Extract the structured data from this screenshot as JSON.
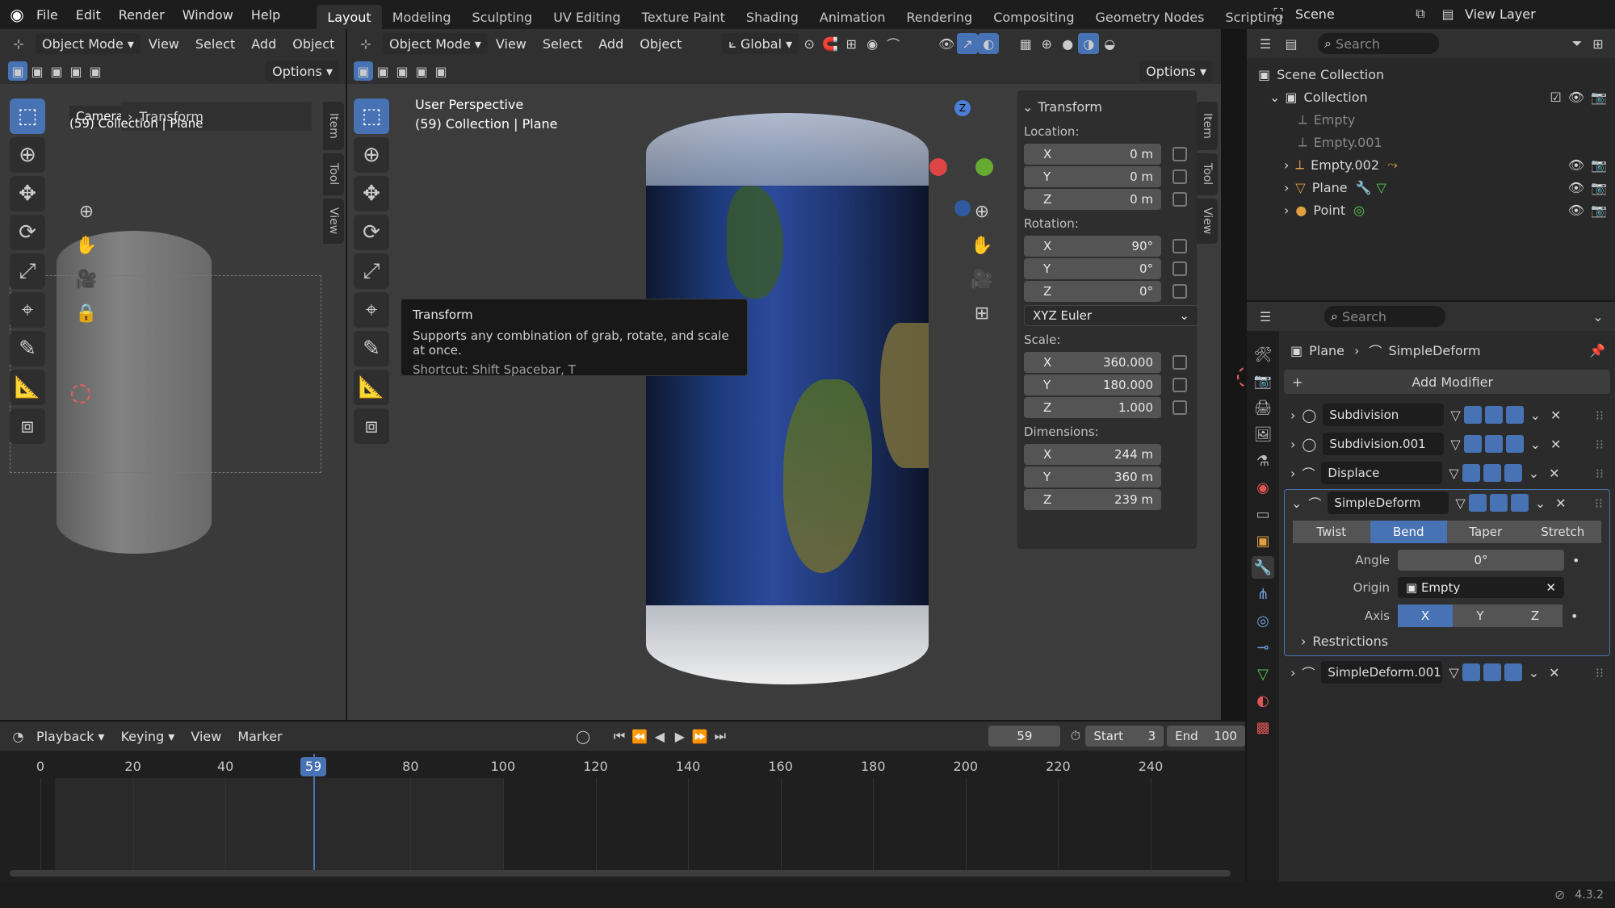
{
  "topbar": {
    "menus": [
      "File",
      "Edit",
      "Render",
      "Window",
      "Help"
    ],
    "workspaces": [
      "Layout",
      "Modeling",
      "Sculpting",
      "UV Editing",
      "Texture Paint",
      "Shading",
      "Animation",
      "Rendering",
      "Compositing",
      "Geometry Nodes",
      "Scripting"
    ],
    "active_workspace": "Layout",
    "add_tab": "+",
    "scene": "Scene",
    "view_layer": "View Layer"
  },
  "left_viewport": {
    "mode": "Object Mode",
    "menus": [
      "View",
      "Select",
      "Add",
      "Object"
    ],
    "options": "Options",
    "camera_title": "Camera I",
    "breadcrumb_transform": "Transform",
    "collection_info": "(59) Collection | Plane",
    "side_tabs": [
      "Item",
      "Tool",
      "View"
    ]
  },
  "main_viewport": {
    "mode": "Object Mode",
    "menus": [
      "View",
      "Select",
      "Add",
      "Object"
    ],
    "orientation": "Global",
    "options": "Options",
    "title": "User Perspective",
    "collection_info": "(59) Collection | Plane",
    "side_tabs": [
      "Item",
      "Tool",
      "View"
    ],
    "tooltip": {
      "title": "Transform",
      "description": "Supports any combination of grab, rotate, and scale at once.",
      "shortcut": "Shortcut: Shift Spacebar, T"
    },
    "gizmo": {
      "z": "Z"
    }
  },
  "transform_panel": {
    "header": "Transform",
    "location_label": "Location:",
    "location": [
      {
        "axis": "X",
        "value": "0 m"
      },
      {
        "axis": "Y",
        "value": "0 m"
      },
      {
        "axis": "Z",
        "value": "0 m"
      }
    ],
    "rotation_label": "Rotation:",
    "rotation": [
      {
        "axis": "X",
        "value": "90°"
      },
      {
        "axis": "Y",
        "value": "0°"
      },
      {
        "axis": "Z",
        "value": "0°"
      }
    ],
    "rotation_mode": "XYZ Euler",
    "scale_label": "Scale:",
    "scale": [
      {
        "axis": "X",
        "value": "360.000"
      },
      {
        "axis": "Y",
        "value": "180.000"
      },
      {
        "axis": "Z",
        "value": "1.000"
      }
    ],
    "dimensions_label": "Dimensions:",
    "dimensions": [
      {
        "axis": "X",
        "value": "244 m"
      },
      {
        "axis": "Y",
        "value": "360 m"
      },
      {
        "axis": "Z",
        "value": "239 m"
      }
    ]
  },
  "outliner": {
    "search_placeholder": "Search",
    "scene_collection": "Scene Collection",
    "collection": "Collection",
    "items": [
      "Empty",
      "Empty.001",
      "Empty.002",
      "Plane",
      "Point"
    ]
  },
  "properties": {
    "search_placeholder": "Search",
    "breadcrumb_object": "Plane",
    "breadcrumb_modifier": "SimpleDeform",
    "add_modifier": "Add Modifier",
    "modifiers": [
      "Subdivision",
      "Subdivision.001",
      "Displace",
      "SimpleDeform",
      "SimpleDeform.001"
    ],
    "deform_modes": [
      "Twist",
      "Bend",
      "Taper",
      "Stretch"
    ],
    "active_mode": "Bend",
    "angle_label": "Angle",
    "angle_value": "0°",
    "origin_label": "Origin",
    "origin_value": "Empty",
    "axis_label": "Axis",
    "axes": [
      "X",
      "Y",
      "Z"
    ],
    "active_axis": "X",
    "restrictions": "Restrictions"
  },
  "timeline": {
    "menus": [
      "Playback",
      "Keying",
      "View",
      "Marker"
    ],
    "current_frame": "59",
    "start_label": "Start",
    "start_value": "3",
    "end_label": "End",
    "end_value": "100",
    "ticks": [
      "0",
      "20",
      "40",
      "59",
      "80",
      "100",
      "120",
      "140",
      "160",
      "180",
      "200",
      "220",
      "240"
    ]
  },
  "statusbar": {
    "version": "4.3.2"
  }
}
